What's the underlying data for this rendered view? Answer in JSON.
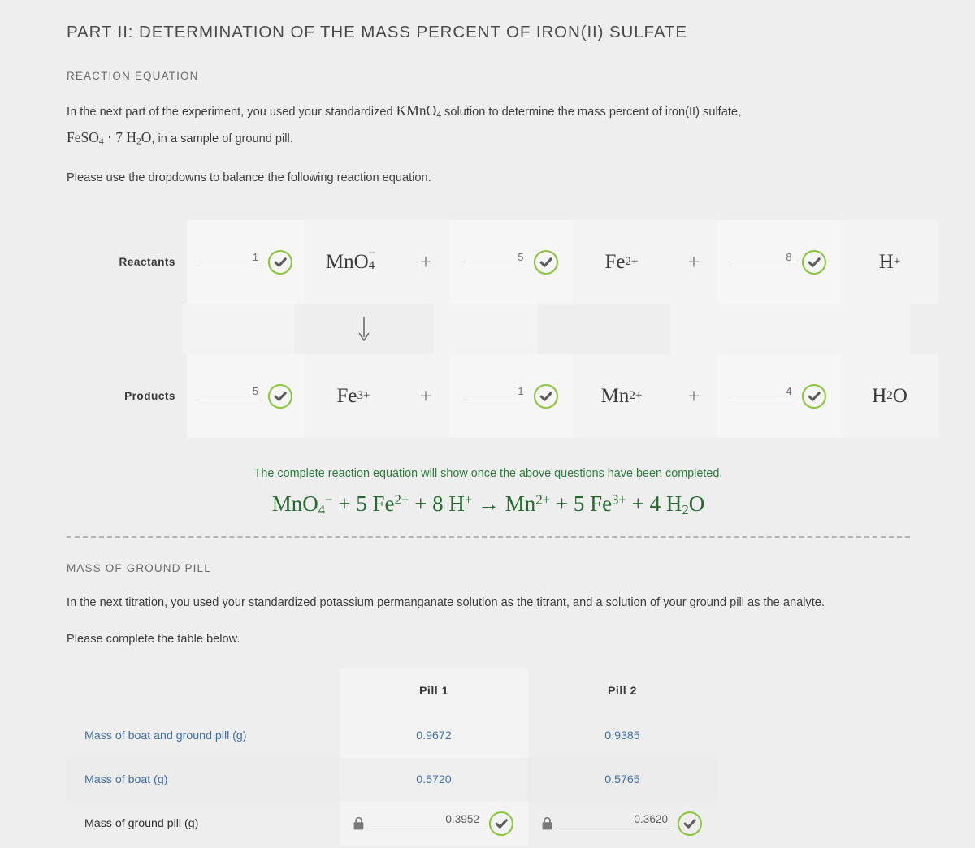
{
  "part_title": "PART II: DETERMINATION OF THE MASS PERCENT OF IRON(II) SULFATE",
  "reaction_section": {
    "heading": "REACTION EQUATION",
    "paragraph_1_a": "In the next part of the experiment, you used your standardized ",
    "paragraph_1_formula_1": "KMnO",
    "paragraph_1_formula_1_sub": "4",
    "paragraph_1_b": " solution to determine the mass percent of iron(II) sulfate,",
    "paragraph_1_formula_2": "FeSO",
    "paragraph_1_formula_2_sub": "4",
    "paragraph_1_formula_mid": " · 7 H",
    "paragraph_1_formula_3_sub": "2",
    "paragraph_1_formula_3_end": "O",
    "paragraph_1_c": ", in a sample of ground pill.",
    "paragraph_2": "Please use the dropdowns to balance the following reaction equation.",
    "reactants_label": "Reactants",
    "products_label": "Products",
    "plus_symbol": "+",
    "arrow_symbol": "↓",
    "reactants": [
      {
        "coefficient": "1",
        "species": "MnO",
        "sub": "4",
        "sup": "−",
        "status": "correct"
      },
      {
        "coefficient": "5",
        "species": "Fe",
        "sub": "",
        "sup": "2+",
        "status": "correct"
      },
      {
        "coefficient": "8",
        "species": "H",
        "sub": "",
        "sup": "+",
        "status": "correct"
      }
    ],
    "products": [
      {
        "coefficient": "5",
        "species": "Fe",
        "sub": "",
        "sup": "3+",
        "status": "correct"
      },
      {
        "coefficient": "1",
        "species": "Mn",
        "sub": "",
        "sup": "2+",
        "status": "correct"
      },
      {
        "coefficient": "4",
        "species": "H",
        "sub": "2",
        "sup": "",
        "status": "correct",
        "trailing": "O"
      }
    ],
    "complete_note": "The complete reaction equation will show once the above questions have been completed.",
    "complete_equation": "MnO4− + 5 Fe2+ + 8 H+ → Mn2+ + 5 Fe3+ + 4 H2O",
    "accent_green": "#2f7d3e",
    "ring_green": "#8cc63f"
  },
  "mass_section": {
    "heading": "MASS OF GROUND PILL",
    "paragraph_1": "In the next titration, you used your standardized potassium permanganate solution as the titrant, and a solution of your ground pill as the analyte.",
    "paragraph_2": "Please complete the table below.",
    "table": {
      "headers": [
        "",
        "Pill 1",
        "Pill 2"
      ],
      "rows": [
        {
          "label": "Mass of boat and ground pill (g)",
          "label_color": "blue",
          "type": "readonly",
          "values": [
            "0.9672",
            "0.9385"
          ]
        },
        {
          "label": "Mass of boat (g)",
          "label_color": "blue",
          "type": "readonly",
          "values": [
            "0.5720",
            "0.5765"
          ]
        },
        {
          "label": "Mass of ground pill (g)",
          "label_color": "plain",
          "type": "input-locked",
          "values": [
            "0.3952",
            "0.3620"
          ],
          "status": [
            "correct",
            "correct"
          ]
        }
      ]
    },
    "value_color": "#3f6fa8"
  }
}
